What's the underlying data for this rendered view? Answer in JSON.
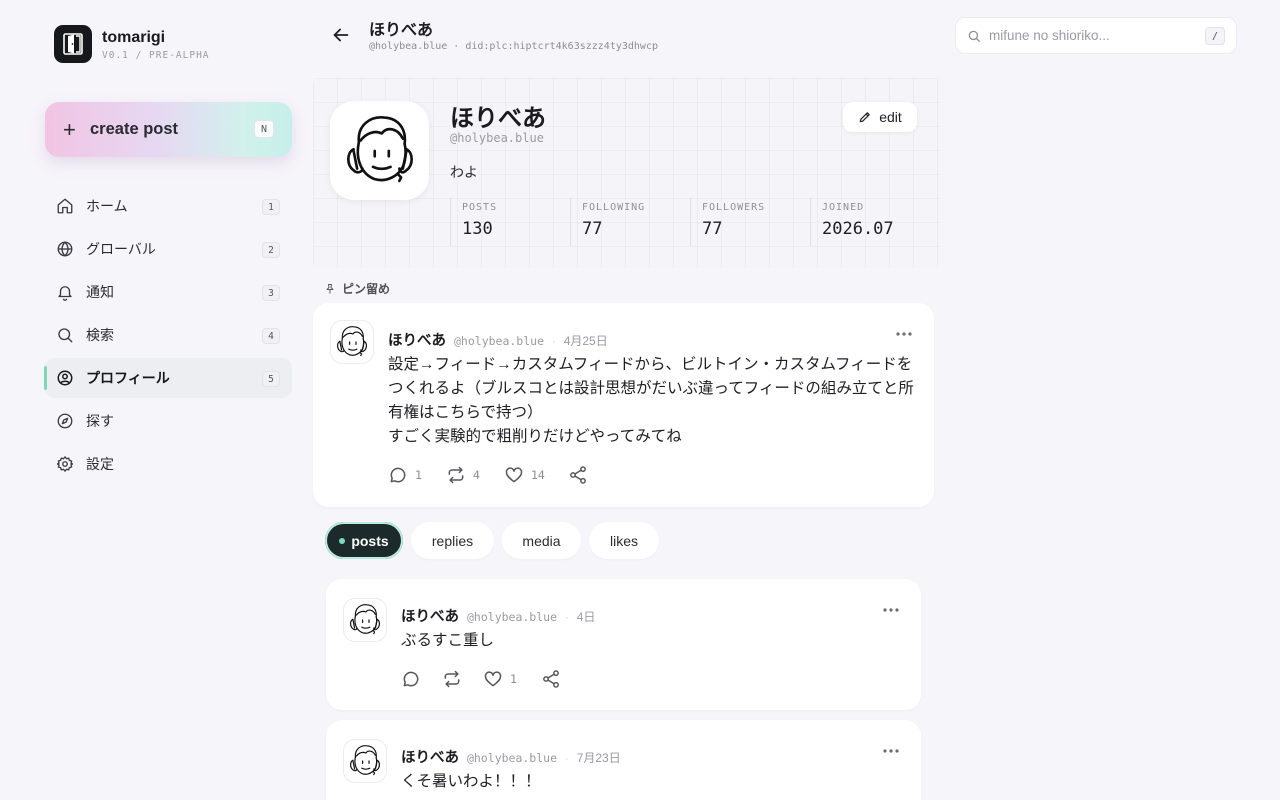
{
  "app": {
    "name": "tomarigi",
    "version": "V0.1 / PRE-ALPHA"
  },
  "create_post": {
    "label": "create post",
    "shortcut": "N"
  },
  "nav": [
    {
      "label": "ホーム",
      "shortcut": "1",
      "icon": "home-icon"
    },
    {
      "label": "グローバル",
      "shortcut": "2",
      "icon": "globe-icon"
    },
    {
      "label": "通知",
      "shortcut": "3",
      "icon": "bell-icon"
    },
    {
      "label": "検索",
      "shortcut": "4",
      "icon": "search-icon"
    },
    {
      "label": "プロフィール",
      "shortcut": "5",
      "icon": "user-circle-icon",
      "active": true
    },
    {
      "label": "探す",
      "shortcut": "",
      "icon": "compass-icon"
    },
    {
      "label": "設定",
      "shortcut": "",
      "icon": "gear-icon"
    }
  ],
  "topbar": {
    "title": "ほりべあ",
    "subtitle": "@holybea.blue · did:plc:hiptcrt4k63szzz4ty3dhwcp"
  },
  "profile": {
    "display_name": "ほりべあ",
    "handle": "@holybea.blue",
    "bio": "わよ",
    "edit_label": "edit",
    "stats": [
      {
        "label": "POSTS",
        "value": "130"
      },
      {
        "label": "FOLLOWING",
        "value": "77"
      },
      {
        "label": "FOLLOWERS",
        "value": "77"
      },
      {
        "label": "JOINED",
        "value": "2026.07"
      }
    ]
  },
  "pinned": {
    "label": "ピン留め",
    "post": {
      "name": "ほりべあ",
      "handle": "@holybea.blue",
      "date": "4月25日",
      "text": "設定→フィード→カスタムフィードから、ビルトイン・カスタムフィードをつくれるよ（ブルスコとは設計思想がだいぶ違ってフィードの組み立てと所有権はこちらで持つ）\nすごく実験的で粗削りだけどやってみてね",
      "replies": "1",
      "reposts": "4",
      "likes": "14"
    }
  },
  "tabs": [
    {
      "label": "posts",
      "active": true
    },
    {
      "label": "replies"
    },
    {
      "label": "media"
    },
    {
      "label": "likes"
    }
  ],
  "feed": [
    {
      "name": "ほりべあ",
      "handle": "@holybea.blue",
      "date": "4日",
      "text": "ぶるすこ重し",
      "replies": "",
      "reposts": "",
      "likes": "1"
    },
    {
      "name": "ほりべあ",
      "handle": "@holybea.blue",
      "date": "7月23日",
      "text": "くそ暑いわよ！！！"
    }
  ],
  "search": {
    "placeholder": "mifune no shioriko...",
    "shortcut": "/"
  },
  "colors": {
    "background": "#f6f5fa",
    "accent": "#7fd9b7",
    "active_tab": "#1c2a2c"
  }
}
